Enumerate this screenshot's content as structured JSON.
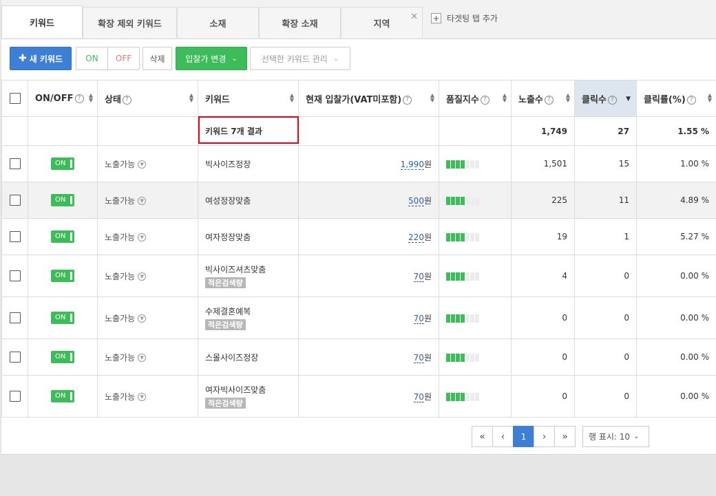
{
  "tabs": [
    {
      "label": "키워드"
    },
    {
      "label": "확장 제외 키워드"
    },
    {
      "label": "소재"
    },
    {
      "label": "확장 소재"
    },
    {
      "label": "지역"
    }
  ],
  "tab_add_label": "타겟팅 탭 추가",
  "toolbar": {
    "new_keyword": "새 키워드",
    "on": "ON",
    "off": "OFF",
    "delete": "삭제",
    "bid_change": "입찰가 변경",
    "manage_selected": "선택한 키워드 관리"
  },
  "columns": {
    "onoff": "ON/OFF",
    "status": "상태",
    "keyword": "키워드",
    "bid": "현재 입찰가(VAT미포함)",
    "quality": "품질지수",
    "impressions": "노출수",
    "clicks": "클릭수",
    "ctr": "클릭률(%)"
  },
  "summary": {
    "label": "키워드 7개 결과",
    "impressions": "1,749",
    "clicks": "27",
    "ctr": "1.55 %"
  },
  "rows": [
    {
      "toggle": "ON",
      "status": "노출가능",
      "keyword": "빅사이즈정장",
      "tag": "",
      "bid": "1,990",
      "unit": "원",
      "quality": 4,
      "impressions": "1,501",
      "clicks": "15",
      "ctr": "1.00 %"
    },
    {
      "toggle": "ON",
      "status": "노출가능",
      "keyword": "여성정장맞춤",
      "tag": "",
      "bid": "500",
      "unit": "원",
      "quality": 4,
      "impressions": "225",
      "clicks": "11",
      "ctr": "4.89 %"
    },
    {
      "toggle": "ON",
      "status": "노출가능",
      "keyword": "여자정장맞춤",
      "tag": "",
      "bid": "220",
      "unit": "원",
      "quality": 4,
      "impressions": "19",
      "clicks": "1",
      "ctr": "5.27 %"
    },
    {
      "toggle": "ON",
      "status": "노출가능",
      "keyword": "빅사이즈셔츠맞춤",
      "tag": "적은검색량",
      "bid": "70",
      "unit": "원",
      "quality": 4,
      "impressions": "4",
      "clicks": "0",
      "ctr": "0.00 %"
    },
    {
      "toggle": "ON",
      "status": "노출가능",
      "keyword": "수제결혼예복",
      "tag": "적은검색량",
      "bid": "70",
      "unit": "원",
      "quality": 4,
      "impressions": "0",
      "clicks": "0",
      "ctr": "0.00 %"
    },
    {
      "toggle": "ON",
      "status": "노출가능",
      "keyword": "스몰사이즈정장",
      "tag": "",
      "bid": "70",
      "unit": "원",
      "quality": 4,
      "impressions": "0",
      "clicks": "0",
      "ctr": "0.00 %"
    },
    {
      "toggle": "ON",
      "status": "노출가능",
      "keyword": "여자빅사이즈맞춤",
      "tag": "적은검색량",
      "bid": "70",
      "unit": "원",
      "quality": 4,
      "impressions": "0",
      "clicks": "0",
      "ctr": "0.00 %"
    }
  ],
  "pagination": {
    "current": "1",
    "rows_per_page": "행 표시: 10"
  },
  "colors": {
    "accent_blue": "#3d7fd6",
    "toggle_green": "#3dbd5a",
    "highlight_red": "#e60012"
  }
}
